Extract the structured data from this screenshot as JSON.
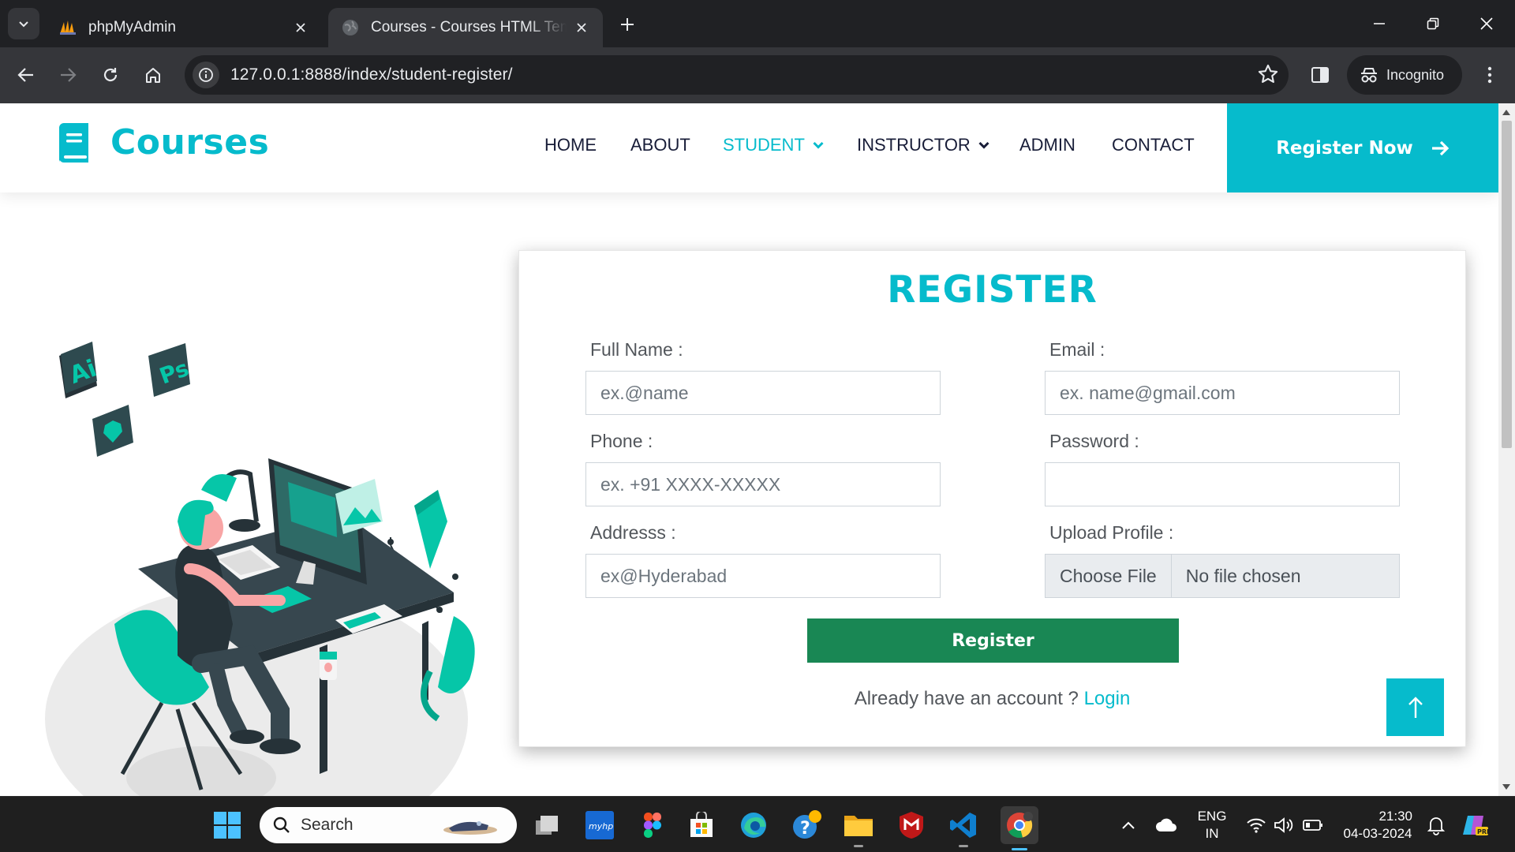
{
  "browser": {
    "tabs": [
      {
        "title": "phpMyAdmin",
        "icon": "phpmyadmin-logo",
        "active": false
      },
      {
        "title": "Courses - Courses HTML Template",
        "icon": "globe-icon",
        "active": true
      }
    ],
    "url": "127.0.0.1:8888/index/student-register/",
    "incognito_label": "Incognito"
  },
  "site": {
    "brand": "Courses",
    "nav": [
      {
        "label": "HOME",
        "active": false,
        "dropdown": false
      },
      {
        "label": "ABOUT",
        "active": false,
        "dropdown": false
      },
      {
        "label": "STUDENT",
        "active": true,
        "dropdown": true
      },
      {
        "label": "INSTRUCTOR",
        "active": false,
        "dropdown": true
      },
      {
        "label": "ADMIN",
        "active": false,
        "dropdown": false
      },
      {
        "label": "CONTACT",
        "active": false,
        "dropdown": false
      }
    ],
    "cta": "Register Now",
    "colors": {
      "primary": "#06bbcc",
      "success": "#198754",
      "dark": "#181d38"
    }
  },
  "form": {
    "title": "REGISTER",
    "full_name": {
      "label": "Full Name :",
      "placeholder": "ex.@name",
      "value": ""
    },
    "email": {
      "label": "Email :",
      "placeholder": "ex. name@gmail.com",
      "value": ""
    },
    "phone": {
      "label": "Phone :",
      "placeholder": "ex. +91 XXXX-XXXXX",
      "value": ""
    },
    "password": {
      "label": "Password :",
      "placeholder": "",
      "value": ""
    },
    "address": {
      "label": "Addresss :",
      "placeholder": "ex@Hyderabad",
      "value": ""
    },
    "upload": {
      "label": "Upload Profile :",
      "button": "Choose File",
      "status": "No file chosen"
    },
    "submit": "Register",
    "login_prompt": "Already have an account ?",
    "login_link": "Login"
  },
  "taskbar": {
    "search_placeholder": "Search",
    "language": "ENG",
    "region": "IN",
    "time": "21:30",
    "date": "04-03-2024"
  }
}
